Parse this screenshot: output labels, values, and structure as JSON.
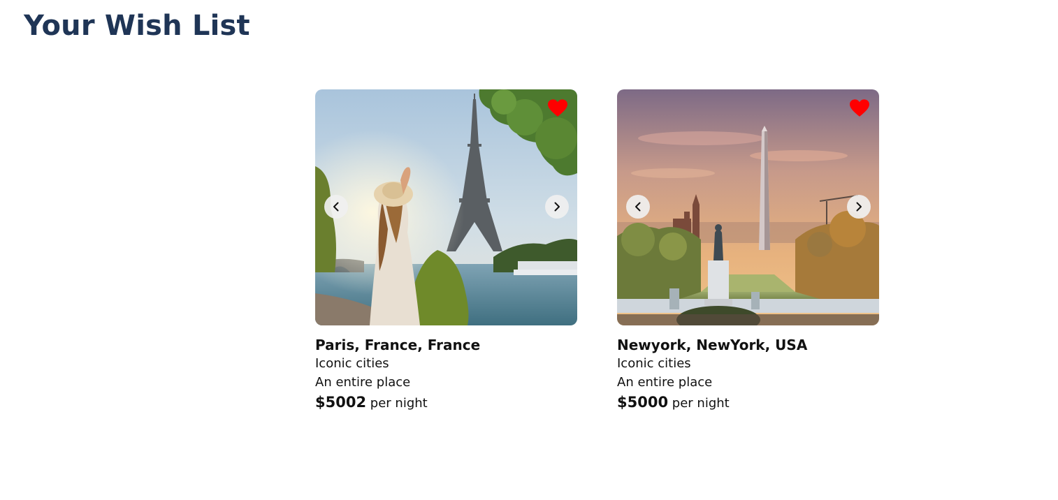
{
  "page": {
    "title": "Your Wish List"
  },
  "colors": {
    "title": "#1f3556",
    "heart": "#ff0000",
    "nav_button_bg": "#f0f0f0"
  },
  "listings": [
    {
      "title": "Paris, France, France",
      "category": "Iconic cities",
      "type": "An entire place",
      "price": "$5002",
      "price_unit": "per night",
      "image": "paris-eiffel-tower-photo",
      "favorited": true
    },
    {
      "title": "Newyork, NewYork, USA",
      "category": "Iconic cities",
      "type": "An entire place",
      "price": "$5000",
      "price_unit": "per night",
      "image": "washington-monument-photo",
      "favorited": true
    }
  ],
  "icons": {
    "heart": "heart-icon",
    "prev": "chevron-left-icon",
    "next": "chevron-right-icon"
  }
}
